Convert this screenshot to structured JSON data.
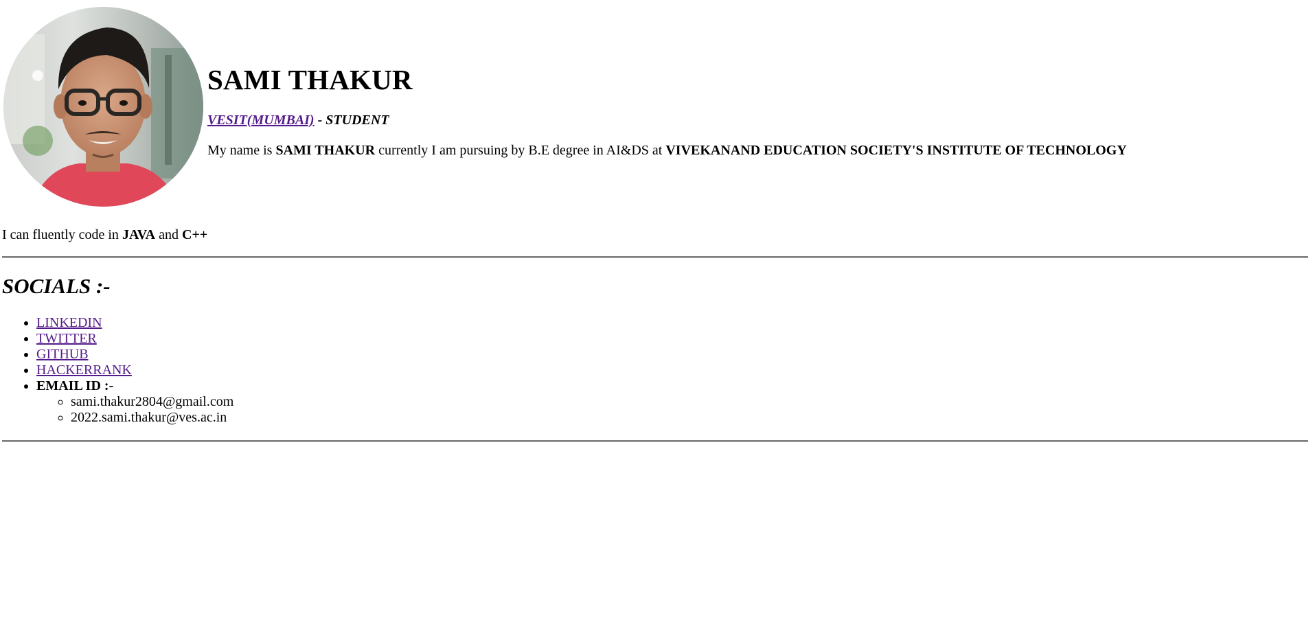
{
  "profile": {
    "name": "SAMI THAKUR",
    "affiliation_link": "VESIT(MUMBAI)",
    "affiliation_role": " - STUDENT",
    "about_prefix": "My name is ",
    "about_name": "SAMI THAKUR",
    "about_middle": " currently I am pursuing by B.E degree in AI&DS at ",
    "about_institute": "VIVEKANAND EDUCATION SOCIETY'S INSTITUTE OF TECHNOLOGY"
  },
  "skills": {
    "prefix": "I can fluently code in ",
    "lang1": "JAVA",
    "joiner": " and ",
    "lang2": "C++"
  },
  "socials": {
    "title": "SOCIALS :-",
    "links": [
      "LINKEDIN",
      "TWITTER",
      "GITHUB",
      "HACKERRANK"
    ],
    "email_label": "EMAIL ID :-",
    "emails": [
      "sami.thakur2804@gmail.com",
      "2022.sami.thakur@ves.ac.in"
    ]
  },
  "colors": {
    "visited_link": "#551a8b",
    "rule": "#808080"
  }
}
